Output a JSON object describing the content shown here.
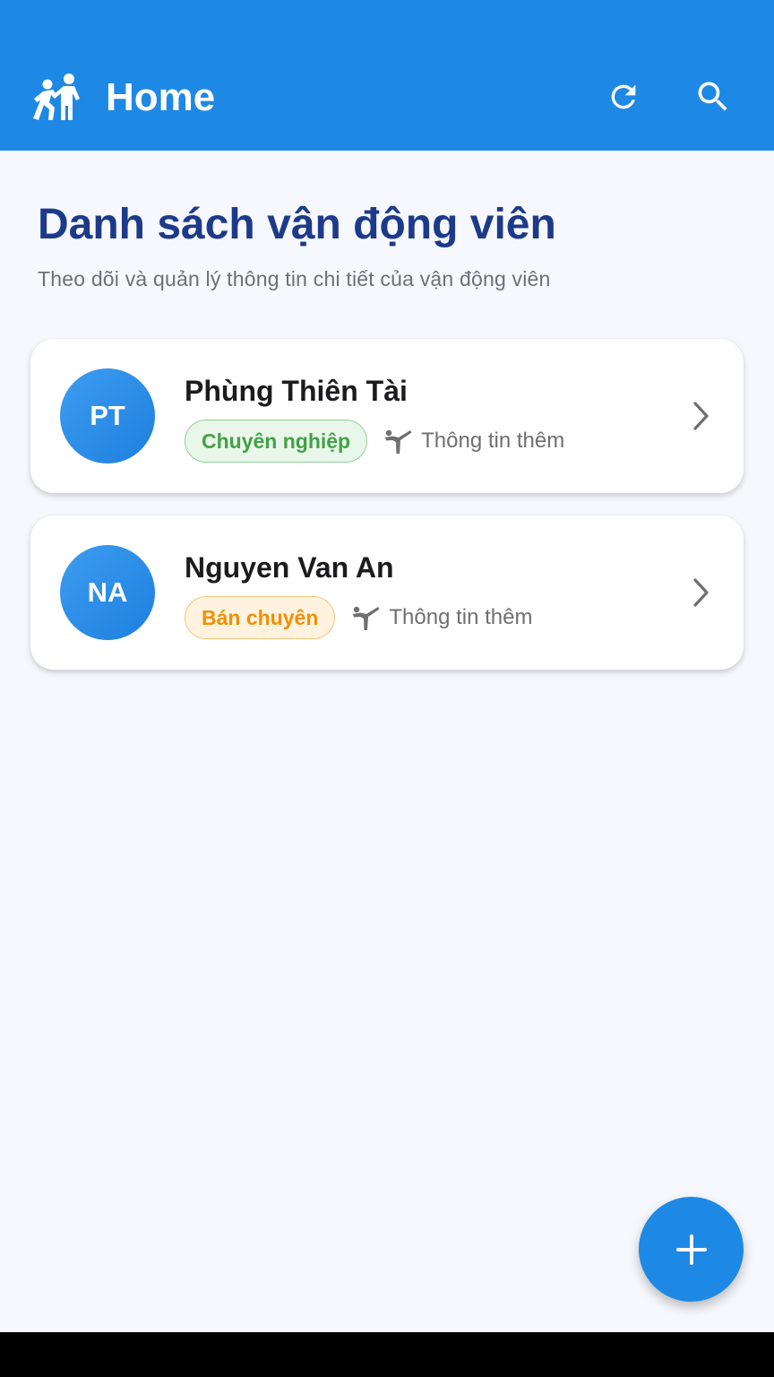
{
  "app_bar": {
    "title": "Home",
    "logo_icon": "sports-kabaddi-icon",
    "actions": [
      "refresh-icon",
      "search-icon"
    ],
    "background_color": "#1e88e5"
  },
  "main": {
    "title": "Danh sách vận động viên",
    "subtitle": "Theo dõi và quản lý thông tin chi tiết của vận động viên",
    "title_color": "#1d3a8a"
  },
  "athletes": [
    {
      "initials": "PT",
      "name": "Phùng Thiên Tài",
      "level": "Chuyên nghiệp",
      "level_color": "#43a047",
      "info_label": "Thông tin thêm",
      "info_icon": "martial-arts-kick-icon"
    },
    {
      "initials": "NA",
      "name": "Nguyen Van An",
      "level": "Bán chuyên",
      "level_color": "#f28f00",
      "info_label": "Thông tin thêm",
      "info_icon": "martial-arts-kick-icon"
    }
  ],
  "fab": {
    "icon": "plus-icon"
  }
}
